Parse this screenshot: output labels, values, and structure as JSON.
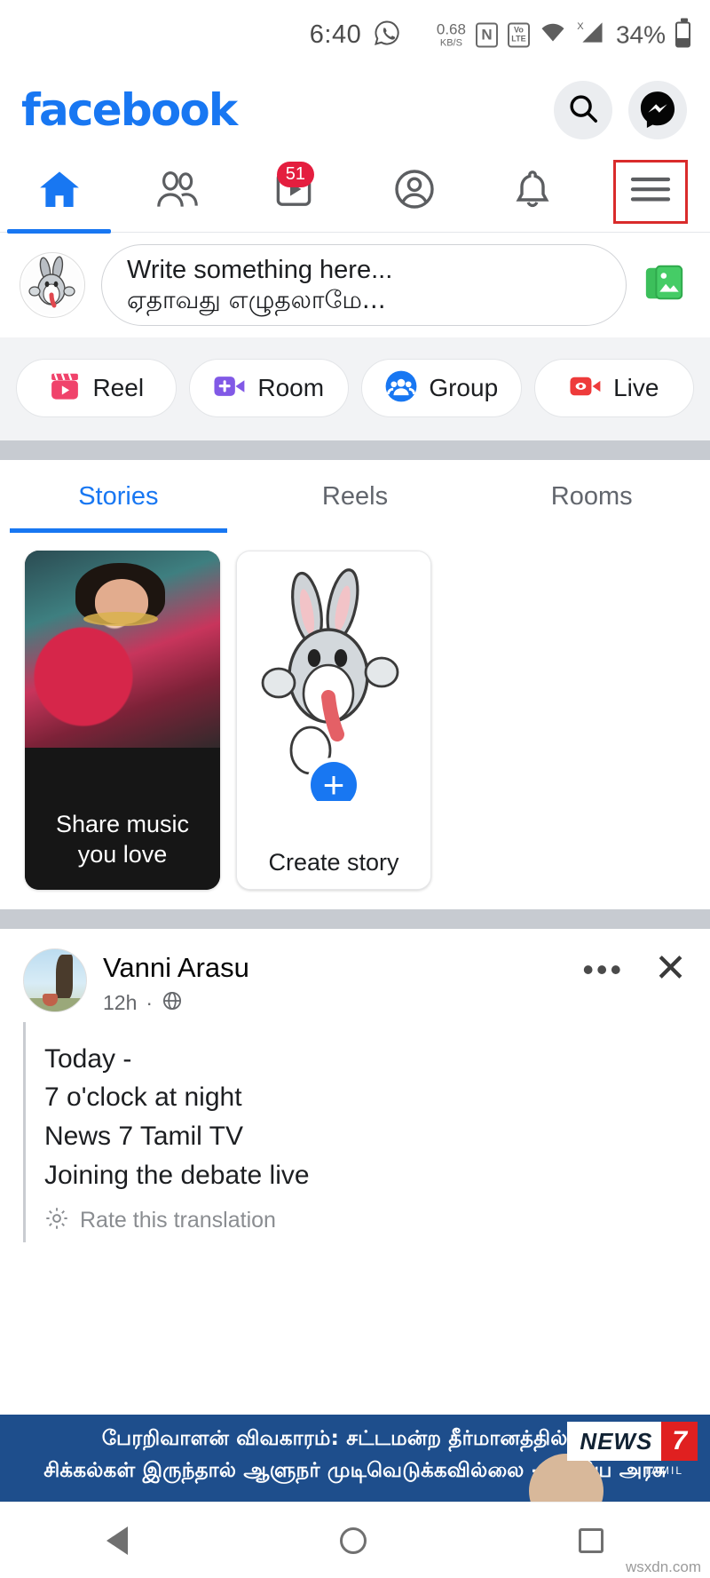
{
  "statusbar": {
    "time": "6:40",
    "whatsapp_icon": "whatsapp-icon",
    "data_rate_value": "0.68",
    "data_rate_unit": "KB/S",
    "nfc_label": "N",
    "volte_top": "Vo",
    "volte_bottom": "LTE",
    "signal_x": "X",
    "battery_percent": "34%"
  },
  "header": {
    "logo": "facebook",
    "search_icon": "search-icon",
    "messenger_icon": "messenger-icon"
  },
  "tabs": [
    {
      "name": "home",
      "icon": "home-icon",
      "active": true,
      "badge": ""
    },
    {
      "name": "friends",
      "icon": "friends-icon",
      "active": false,
      "badge": ""
    },
    {
      "name": "watch",
      "icon": "watch-icon",
      "active": false,
      "badge": "51"
    },
    {
      "name": "profile",
      "icon": "profile-icon",
      "active": false,
      "badge": ""
    },
    {
      "name": "notifications",
      "icon": "bell-icon",
      "active": false,
      "badge": ""
    },
    {
      "name": "menu",
      "icon": "hamburger-menu-icon",
      "active": false,
      "badge": "",
      "highlight_color": "#D92B2B"
    }
  ],
  "composer": {
    "avatar_icon": "bugs-bunny-avatar",
    "placeholder_en": "Write something here...",
    "placeholder_ta": "ஏதாவது எழுதலாமே...",
    "photo_icon": "photo-gallery-icon"
  },
  "action_chips": [
    {
      "label": "Reel",
      "icon": "reel-icon",
      "color": "#F0436B"
    },
    {
      "label": "Room",
      "icon": "room-video-icon",
      "color": "#8159E6"
    },
    {
      "label": "Group",
      "icon": "group-people-icon",
      "color": "#1877F2"
    },
    {
      "label": "Live",
      "icon": "live-video-icon",
      "color": "#EE3B3B"
    }
  ],
  "story_tabs": [
    {
      "label": "Stories",
      "active": true
    },
    {
      "label": "Reels",
      "active": false
    },
    {
      "label": "Rooms",
      "active": false
    }
  ],
  "stories": [
    {
      "type": "music",
      "caption_line1": "Share music",
      "caption_line2": "you love",
      "name": "share-music-story"
    },
    {
      "type": "create",
      "label": "Create story",
      "plus_icon": "plus-icon",
      "name": "create-story"
    }
  ],
  "post": {
    "avatar_icon": "profile-photo-avatar",
    "author": "Vanni Arasu",
    "time": "12h",
    "separator": "·",
    "privacy_icon": "globe-icon",
    "more_icon": "more-options-icon",
    "close_icon": "close-icon",
    "body_lines": [
      "Today -",
      "7 o'clock at night",
      "News 7 Tamil TV",
      "Joining the debate live"
    ],
    "translate_icon": "gear-icon",
    "translate_label": "Rate this translation"
  },
  "ticker": {
    "line1": "பேரறிவாளன் விவகாரம்: சட்டமன்ற தீர்மானத்தில் சில",
    "line2": "சிக்கல்கள் இருந்தால் ஆளுநர் முடிவெடுக்கவில்லை - மத்திய அரசு",
    "logo_word": "NEWS",
    "logo_number": "7",
    "logo_sub": "TAMIL",
    "bg_color": "#1E4E8C"
  },
  "navbar": {
    "back_icon": "back-triangle-icon",
    "home_icon": "home-circle-icon",
    "recents_icon": "recents-square-icon"
  },
  "watermark": "wsxdn.com"
}
